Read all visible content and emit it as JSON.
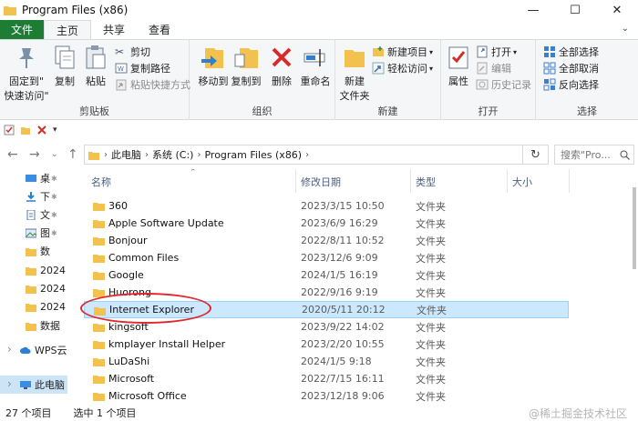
{
  "window": {
    "title": "Program Files (x86)",
    "controls": [
      "—",
      "☐",
      "✕"
    ]
  },
  "tabs": [
    {
      "label": "文件"
    },
    {
      "label": "主页"
    },
    {
      "label": "共享"
    },
    {
      "label": "查看"
    }
  ],
  "ribbon": {
    "clipboard": {
      "pin_label": "固定到\"快速访问\"",
      "pin_line1": "固定到\"",
      "pin_line2": "快速访问\"",
      "copy_label": "复制",
      "paste_label": "粘贴",
      "cut_label": "剪切",
      "copy_path_label": "复制路径",
      "paste_shortcut_label": "粘贴快捷方式",
      "group_label": "剪贴板"
    },
    "organize": {
      "move_to_label": "移动到",
      "copy_to_label": "复制到",
      "delete_label": "删除",
      "rename_label": "重命名",
      "group_label": "组织"
    },
    "new": {
      "new_item_label": "新建项目",
      "easy_access_label": "轻松访问",
      "new_folder_line1": "新建",
      "new_folder_line2": "文件夹",
      "group_label": "新建"
    },
    "open": {
      "properties_label": "属性",
      "open_label": "打开",
      "edit_label": "编辑",
      "history_label": "历史记录",
      "group_label": "打开"
    },
    "select": {
      "select_all_label": "全部选择",
      "select_none_label": "全部取消",
      "invert_label": "反向选择",
      "group_label": "选择"
    }
  },
  "address": {
    "segments": [
      "此电脑",
      "系统 (C:)",
      "Program Files (x86)"
    ],
    "search_placeholder": "搜索\"Pro..."
  },
  "sidebar": {
    "items": [
      {
        "label": "桌",
        "icon": "desktop-icon",
        "pinned": true
      },
      {
        "label": "下",
        "icon": "download-icon",
        "pinned": true
      },
      {
        "label": "文",
        "icon": "document-icon",
        "pinned": true
      },
      {
        "label": "图",
        "icon": "picture-icon",
        "pinned": true
      },
      {
        "label": "数",
        "icon": "folder-icon",
        "pinned": false
      },
      {
        "label": "2024",
        "icon": "folder-icon",
        "pinned": false
      },
      {
        "label": "2024",
        "icon": "folder-icon",
        "pinned": false
      },
      {
        "label": "2024",
        "icon": "folder-icon",
        "pinned": false
      },
      {
        "label": "数据",
        "icon": "folder-icon",
        "pinned": false
      },
      {
        "label": "WPS云",
        "icon": "cloud-icon",
        "pinned": false
      },
      {
        "label": "此电脑",
        "icon": "computer-icon",
        "pinned": false
      }
    ]
  },
  "columns": {
    "name": "名称",
    "date": "修改日期",
    "type": "类型",
    "size": "大小"
  },
  "files": [
    {
      "name": "360",
      "date": "2023/3/15 10:50",
      "type": "文件夹"
    },
    {
      "name": "Apple Software Update",
      "date": "2023/6/9 16:29",
      "type": "文件夹"
    },
    {
      "name": "Bonjour",
      "date": "2022/8/11 10:52",
      "type": "文件夹"
    },
    {
      "name": "Common Files",
      "date": "2023/12/6 9:09",
      "type": "文件夹"
    },
    {
      "name": "Google",
      "date": "2024/1/5 16:19",
      "type": "文件夹"
    },
    {
      "name": "Huorong",
      "date": "2022/9/16 9:19",
      "type": "文件夹"
    },
    {
      "name": "Internet Explorer",
      "date": "2020/5/11 20:12",
      "type": "文件夹"
    },
    {
      "name": "kingsoft",
      "date": "2023/9/22 14:02",
      "type": "文件夹"
    },
    {
      "name": "kmplayer Install Helper",
      "date": "2023/2/20 10:55",
      "type": "文件夹"
    },
    {
      "name": "LuDaShi",
      "date": "2024/1/5 9:18",
      "type": "文件夹"
    },
    {
      "name": "Microsoft",
      "date": "2022/7/15 16:11",
      "type": "文件夹"
    },
    {
      "name": "Microsoft Office",
      "date": "2023/12/18 9:06",
      "type": "文件夹"
    }
  ],
  "selected_index": 6,
  "status": {
    "count": "27 个项目",
    "selection": "选中 1 个项目"
  },
  "watermark": "@稀土掘金技术社区",
  "colors": {
    "file_tab": "#1e7d34",
    "folder": "#f2c14e",
    "selection": "#cce8ff",
    "highlight": "#e0272d"
  }
}
